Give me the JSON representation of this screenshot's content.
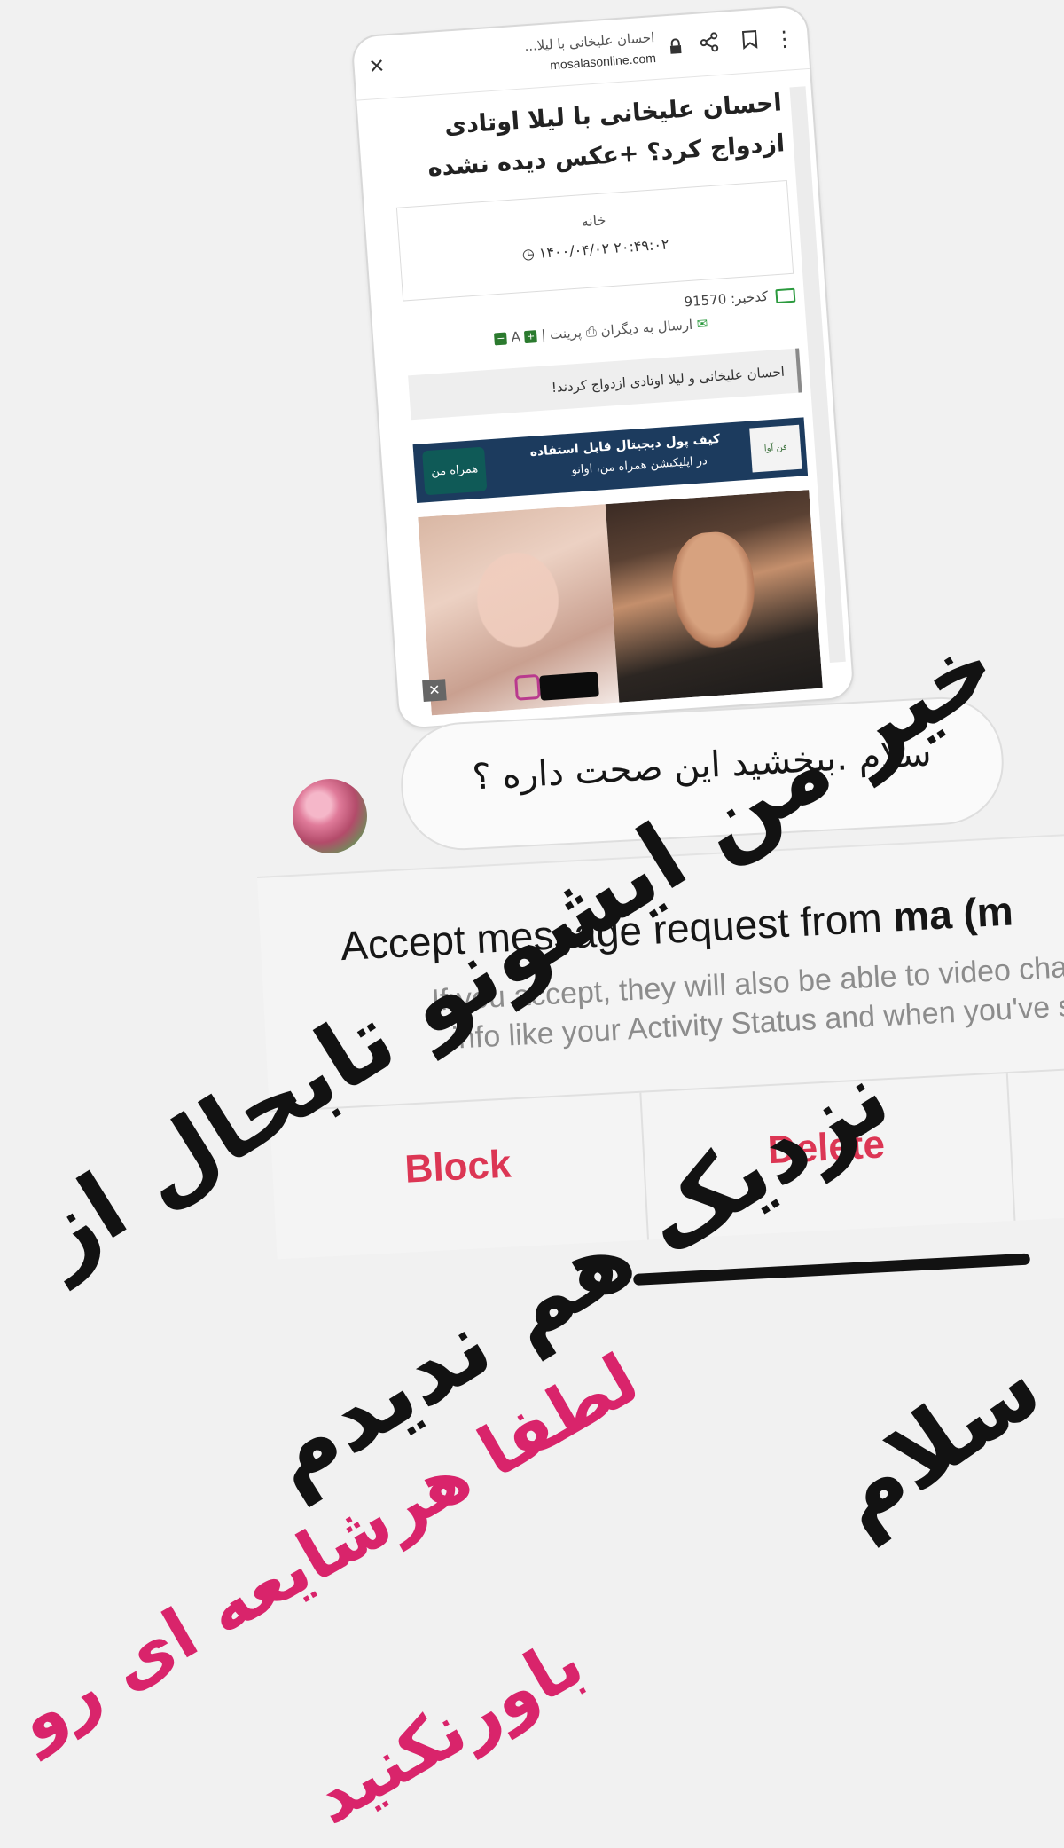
{
  "browser": {
    "title": "احسان علیخانی با لیلا...",
    "url": "mosalasonline.com",
    "icons": [
      "close-icon",
      "lock-icon",
      "share-icon",
      "bookmark-icon",
      "more-vertical-icon"
    ]
  },
  "article": {
    "headline": "احسان علیخانی با لیلا اوتادی ازدواج کرد؟ +عکس دیده نشده",
    "breadcrumb": "خانه",
    "datetime": "۱۴۰۰/۰۴/۰۲ ۲۰:۴۹:۰۲",
    "news_id_label": "کدخبر: 91570",
    "send_label": "ارسال به دیگران",
    "print_label": "پرینت",
    "font_size_label": "A",
    "summary": "احسان علیخانی و لیلا اوتادی ازدواج کردند!",
    "ad": {
      "brand": "فن آوا",
      "line1": "کیف پول دیجیتال قابل استفاده",
      "line2": "در اپلیکیشن همراه من، اوانو",
      "logo": "همراه من"
    },
    "close_ad_label": "✕"
  },
  "message": {
    "text": "سلام .ببخشید این صحت داره ؟"
  },
  "request": {
    "title_prefix": "Accept message request from",
    "title_user": "ma (m",
    "body_line1": "If you accept, they will also be able to video chat w",
    "body_line2": "info like your Activity Status and when you've se",
    "block_label": "Block",
    "delete_label": "Delete",
    "accent_color": "#dc3654"
  },
  "handwriting": {
    "line1": "سلام",
    "line2": "خیر من ایشونو تابحال از",
    "line3": "نزدیک هم ندیدم",
    "line4": "لطفا هرشایعه ای رو",
    "line5": "باورنکنید",
    "pink_color": "#d9246b"
  }
}
